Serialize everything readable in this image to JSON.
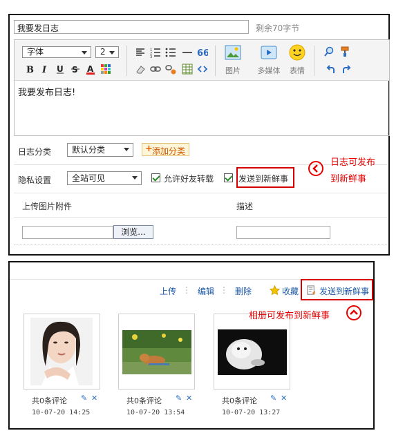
{
  "editor": {
    "title_value": "我要发日志",
    "remaining": "剩余70字节",
    "font_label": "字体",
    "size_value": "2",
    "toolbar_captions": {
      "image": "图片",
      "media": "多媒体",
      "emoticon": "表情"
    },
    "body_text": "我要发布日志!",
    "category_label": "日志分类",
    "category_value": "默认分类",
    "add_category": "添加分类",
    "privacy_label": "隐私设置",
    "privacy_value": "全站可见",
    "allow_repost": "允许好友转载",
    "send_to_feed": "发送到新鲜事",
    "upload_label": "上传图片附件",
    "desc_label": "描述",
    "browse_button": "浏览..."
  },
  "annotations": {
    "diary_line1": "日志可发布",
    "diary_line2": "到新鲜事",
    "album_text": "相册可发布到新鲜事",
    "color": "#e60000"
  },
  "album": {
    "actions": {
      "upload": "上传",
      "edit": "编辑",
      "delete": "删除",
      "favorite": "收藏",
      "send": "发送到新鲜事"
    },
    "photos": [
      {
        "comments": "共0条评论",
        "date": "10-07-20 14:25"
      },
      {
        "comments": "共0条评论",
        "date": "10-07-20 13:54"
      },
      {
        "comments": "共0条评论",
        "date": "10-07-20 13:27"
      }
    ]
  }
}
